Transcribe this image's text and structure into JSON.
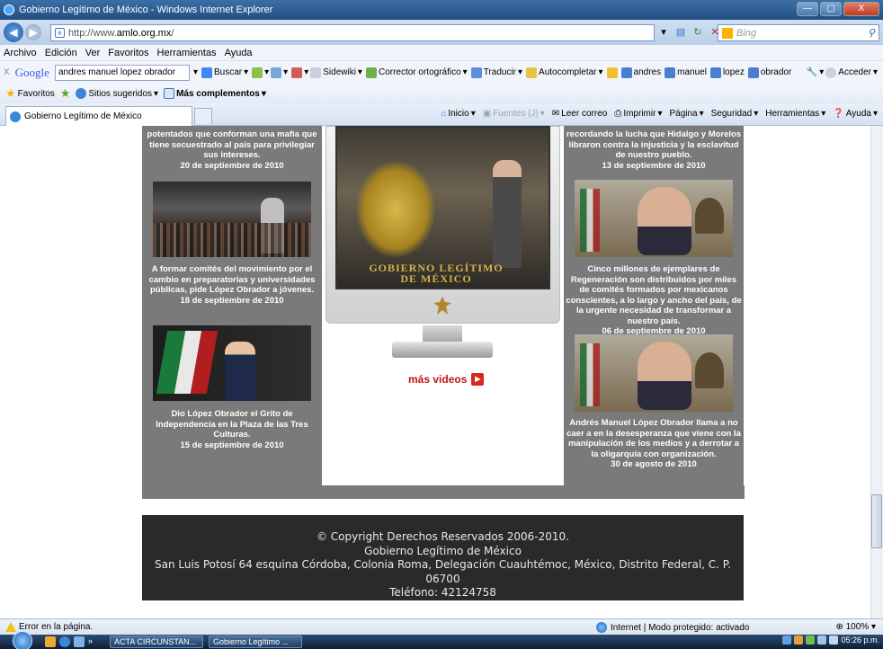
{
  "window": {
    "title": "Gobierno Legítimo de México - Windows Internet Explorer",
    "buttons": {
      "minimize": "—",
      "maximize": "▢",
      "close": "X"
    }
  },
  "address_bar": {
    "back": "◀",
    "forward": "▶",
    "url_prefix": "http://www.",
    "url_host": "amlo.org.mx",
    "url_suffix": "/",
    "search_placeholder": "Bing"
  },
  "menu": [
    "Archivo",
    "Edición",
    "Ver",
    "Favoritos",
    "Herramientas",
    "Ayuda"
  ],
  "google_toolbar": {
    "close": "X",
    "logo": "Google",
    "query": "andres manuel lopez obrador",
    "buscar": "Buscar",
    "sidewiki": "Sidewiki",
    "corrector": "Corrector ortográfico",
    "traducir": "Traducir",
    "autocompletar": "Autocompletar",
    "highlights": [
      "andres",
      "manuel",
      "lopez",
      "obrador"
    ],
    "acceder": "Acceder"
  },
  "favorites_bar": {
    "favoritos": "Favoritos",
    "sitios": "Sitios sugeridos",
    "complementos": "Más complementos"
  },
  "tab": {
    "label": "Gobierno Legítimo de México"
  },
  "commands": {
    "inicio": "Inicio",
    "fuentes": "Fuentes (J)",
    "leer_correo": "Leer correo",
    "imprimir": "Imprimir",
    "pagina": "Página",
    "seguridad": "Seguridad",
    "herramientas": "Herramientas",
    "ayuda": "Ayuda"
  },
  "news_left": [
    {
      "text": "potentados que conforman una mafia que tiene secuestrado al país para privilegiar sus intereses.",
      "date": "20 de septiembre de 2010"
    },
    {
      "text": "A formar comités del movimiento por el cambio en preparatorias y universidades públicas, pide López Obrador a jóvenes.",
      "date": "18 de septiembre de 2010"
    },
    {
      "text": "Dio López Obrador el Grito de Independencia en la Plaza de las Tres Culturas.",
      "date": "15 de septiembre de 2010"
    }
  ],
  "news_right": [
    {
      "text": "recordando la lucha que Hidalgo y Morelos libraron contra la injusticia y la esclavitud de nuestro pueblo.",
      "date": "13 de septiembre de 2010"
    },
    {
      "text": "Cinco millones de ejemplares de Regeneración son distribuidos por miles de comités formados por mexicanos conscientes, a lo largo y ancho del país, de la urgente necesidad de transformar a nuestro país.",
      "date": "06 de septiembre de 2010"
    },
    {
      "text": "Andrés Manuel López Obrador llama a no caer a en la desesperanza que viene con la manipulación de los medios y a derrotar a la oligarquía con organización.",
      "date": "30 de agosto de 2010"
    }
  ],
  "video": {
    "screen_text_line1": "GOBIERNO LEGÍTIMO",
    "screen_text_line2": "DE MÉXICO",
    "more_videos": "más videos"
  },
  "footer": {
    "line1": "© Copyright Derechos Reservados 2006-2010.",
    "line2": "Gobierno Legítimo de México",
    "line3": "San Luis Potosí 64 esquina Córdoba, Colonia Roma, Delegación Cuauhtémoc, México, Distrito Federal, C. P. 06700",
    "line4": "Teléfono: 42124758"
  },
  "status_bar": {
    "error": "Error en la página.",
    "zone": "Internet | Modo protegido: activado",
    "zoom": "100%"
  },
  "taskbar": {
    "more": "»",
    "task1": "ACTA CIRCUNSTAN...",
    "task2": "Gobierno Legítimo ...",
    "clock": "05:26 p.m."
  },
  "colors": {
    "panel_gray": "#7a7a7a",
    "footer_bg": "#2a2a2a",
    "more_videos_red": "#c01616"
  }
}
